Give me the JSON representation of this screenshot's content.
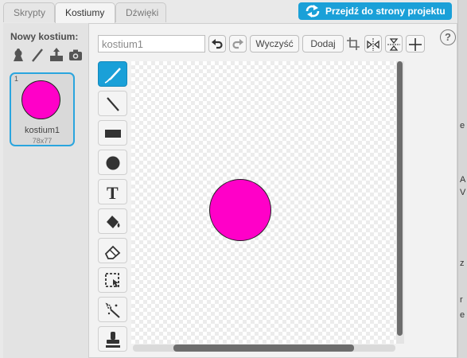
{
  "tabs": [
    {
      "label": "Skrypty",
      "active": false
    },
    {
      "label": "Kostiumy",
      "active": true
    },
    {
      "label": "Dźwięki",
      "active": false
    }
  ],
  "header": {
    "project_button_label": "Przejdź do strony projektu"
  },
  "left_panel": {
    "new_costume_label": "Nowy kostium:",
    "new_costume_icons": [
      "sprite-library-icon",
      "paint-brush-icon",
      "upload-icon",
      "camera-icon"
    ],
    "costumes": [
      {
        "index": "1",
        "name": "kostium1",
        "size": "78x77",
        "selected": true,
        "fill": "#ff00c8"
      }
    ]
  },
  "toolbar": {
    "name_value": "",
    "name_placeholder": "kostium1",
    "undo_icon": "undo-icon",
    "redo_icon": "redo-icon",
    "clear_label": "Wyczyść",
    "add_label": "Dodaj"
  },
  "tools": [
    {
      "name": "brush-tool",
      "active": true
    },
    {
      "name": "line-tool",
      "active": false
    },
    {
      "name": "rectangle-tool",
      "active": false
    },
    {
      "name": "ellipse-tool",
      "active": false
    },
    {
      "name": "text-tool",
      "active": false
    },
    {
      "name": "fill-tool",
      "active": false
    },
    {
      "name": "eraser-tool",
      "active": false
    },
    {
      "name": "select-tool",
      "active": false
    },
    {
      "name": "magic-select-tool",
      "active": false
    },
    {
      "name": "stamp-tool",
      "active": false
    }
  ],
  "canvas": {
    "shape": "circle",
    "fill": "#ff00c8",
    "stroke": "#222222"
  },
  "help_label": "?",
  "side_fragments": [
    "e",
    "A",
    "V",
    "z",
    "r",
    "e"
  ],
  "colors": {
    "accent": "#1aa0d8",
    "costume_fill": "#ff00c8"
  }
}
